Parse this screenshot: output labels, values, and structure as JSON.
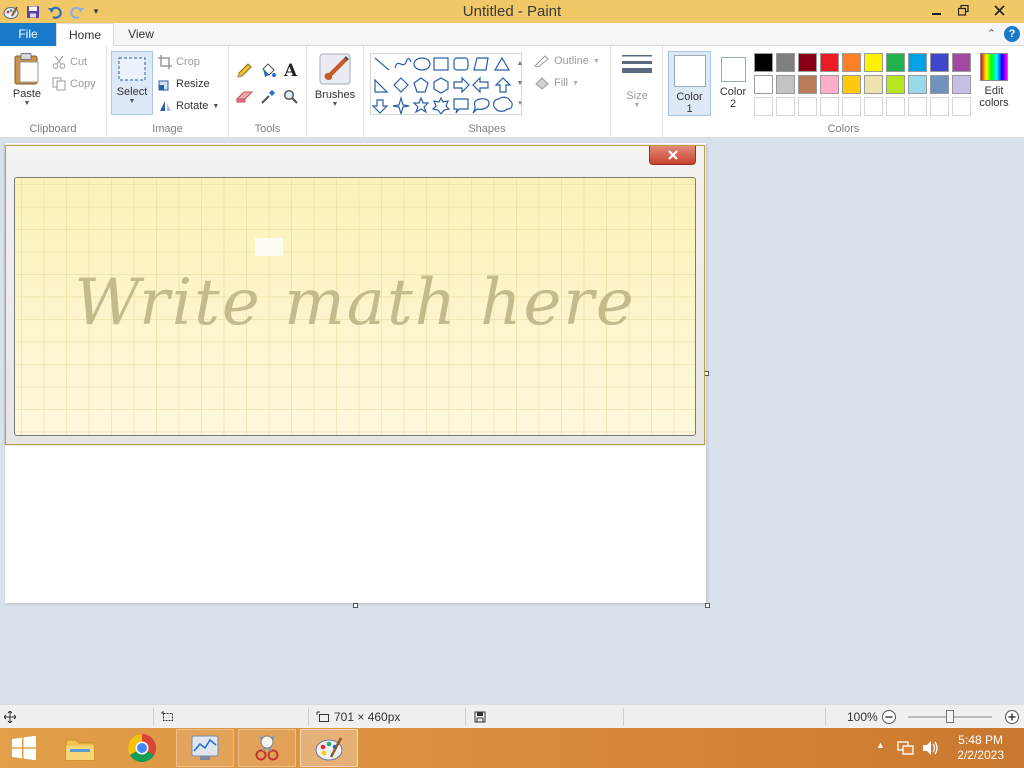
{
  "window": {
    "title": "Untitled - Paint"
  },
  "tabs": {
    "file": "File",
    "home": "Home",
    "view": "View"
  },
  "clipboard": {
    "paste": "Paste",
    "cut": "Cut",
    "copy": "Copy",
    "label": "Clipboard"
  },
  "image": {
    "select": "Select",
    "crop": "Crop",
    "resize": "Resize",
    "rotate": "Rotate",
    "label": "Image"
  },
  "tools": {
    "label": "Tools"
  },
  "brushes": {
    "label": "Brushes"
  },
  "shapes": {
    "outline": "Outline",
    "fill": "Fill",
    "label": "Shapes"
  },
  "size": {
    "label": "Size"
  },
  "colors": {
    "color1": "Color 1",
    "color2": "Color 2",
    "edit": "Edit colors",
    "label": "Colors",
    "palette_row1": [
      "#000000",
      "#7f7f7f",
      "#880015",
      "#ed1c24",
      "#ff7f27",
      "#fff200",
      "#22b14c",
      "#00a2e8",
      "#3f48cc",
      "#a349a4"
    ],
    "palette_row2": [
      "#ffffff",
      "#c3c3c3",
      "#b97a57",
      "#ffaec9",
      "#ffc90e",
      "#efe4b0",
      "#b5e61d",
      "#99d9ea",
      "#7092be",
      "#c8bfe7"
    ]
  },
  "math_panel": {
    "hint": "Write math here",
    "close_icon": "close-icon"
  },
  "status": {
    "canvas_size": "701 × 460px",
    "zoom": "100%"
  },
  "taskbar": {
    "time": "5:48 PM",
    "date": "2/2/2023"
  }
}
